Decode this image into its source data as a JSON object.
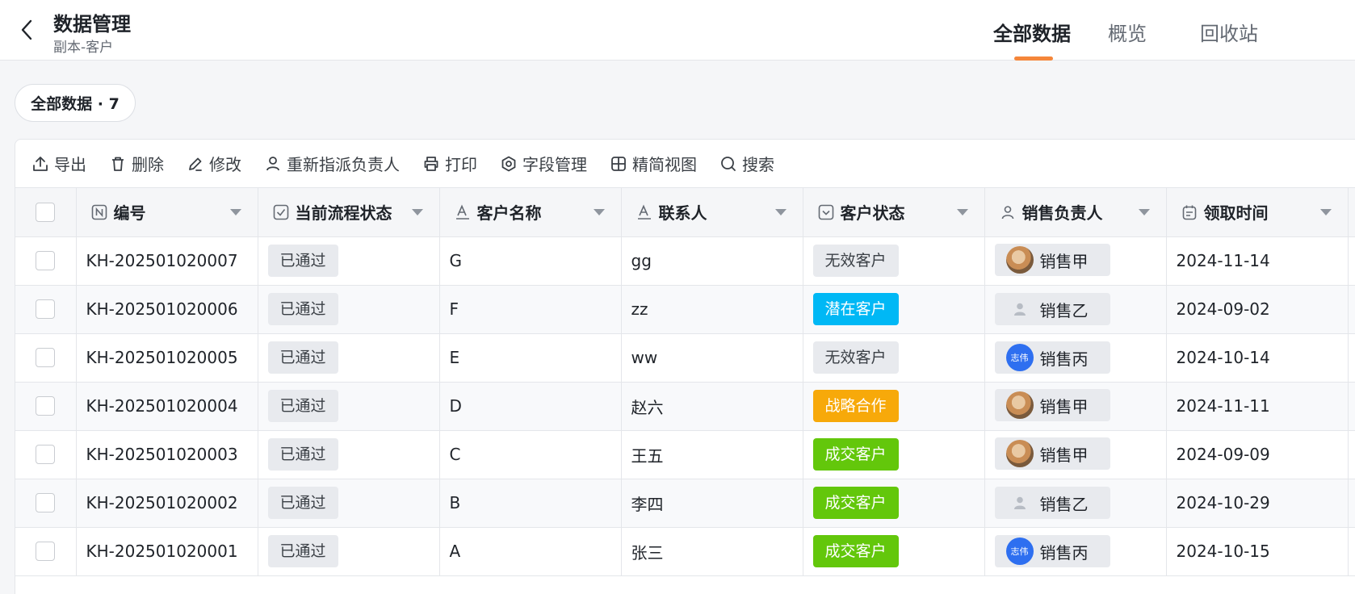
{
  "header": {
    "title": "数据管理",
    "subtitle": "副本-客户",
    "tabs": [
      {
        "label": "全部数据",
        "active": true
      },
      {
        "label": "概览",
        "active": false
      },
      {
        "label": "回收站",
        "active": false
      }
    ]
  },
  "view_pill": "全部数据 · 7",
  "toolbar": {
    "export": "导出",
    "delete": "删除",
    "edit": "修改",
    "reassign": "重新指派负责人",
    "print": "打印",
    "fields": "字段管理",
    "compact": "精简视图",
    "search": "搜索"
  },
  "columns": {
    "id": "编号",
    "flow_status": "当前流程状态",
    "customer_name": "客户名称",
    "contact": "联系人",
    "customer_status": "客户状态",
    "sales_owner": "销售负责人",
    "claim_time": "领取时间"
  },
  "status_colors": {
    "无效客户": "#e8eaee",
    "潜在客户": "#00b8f5",
    "战略合作": "#f7a90a",
    "成交客户": "#63c70b"
  },
  "avatar_label": "志伟",
  "rows": [
    {
      "id": "KH-202501020007",
      "flow": "已通过",
      "name": "G",
      "contact": "gg",
      "status": "无效客户",
      "status_color": "#e8eaee",
      "status_text_color": "#3a3f45",
      "owner": "销售甲",
      "avatar": "cat",
      "time": "2024-11-14"
    },
    {
      "id": "KH-202501020006",
      "flow": "已通过",
      "name": "F",
      "contact": "zz",
      "status": "潜在客户",
      "status_color": "#00b8f5",
      "status_text_color": "#ffffff",
      "owner": "销售乙",
      "avatar": "default",
      "time": "2024-09-02"
    },
    {
      "id": "KH-202501020005",
      "flow": "已通过",
      "name": "E",
      "contact": "ww",
      "status": "无效客户",
      "status_color": "#e8eaee",
      "status_text_color": "#3a3f45",
      "owner": "销售丙",
      "avatar": "blue",
      "time": "2024-10-14"
    },
    {
      "id": "KH-202501020004",
      "flow": "已通过",
      "name": "D",
      "contact": "赵六",
      "status": "战略合作",
      "status_color": "#f7a90a",
      "status_text_color": "#ffffff",
      "owner": "销售甲",
      "avatar": "cat",
      "time": "2024-11-11"
    },
    {
      "id": "KH-202501020003",
      "flow": "已通过",
      "name": "C",
      "contact": "王五",
      "status": "成交客户",
      "status_color": "#63c70b",
      "status_text_color": "#ffffff",
      "owner": "销售甲",
      "avatar": "cat",
      "time": "2024-09-09"
    },
    {
      "id": "KH-202501020002",
      "flow": "已通过",
      "name": "B",
      "contact": "李四",
      "status": "成交客户",
      "status_color": "#63c70b",
      "status_text_color": "#ffffff",
      "owner": "销售乙",
      "avatar": "default",
      "time": "2024-10-29"
    },
    {
      "id": "KH-202501020001",
      "flow": "已通过",
      "name": "A",
      "contact": "张三",
      "status": "成交客户",
      "status_color": "#63c70b",
      "status_text_color": "#ffffff",
      "owner": "销售丙",
      "avatar": "blue",
      "time": "2024-10-15"
    }
  ]
}
